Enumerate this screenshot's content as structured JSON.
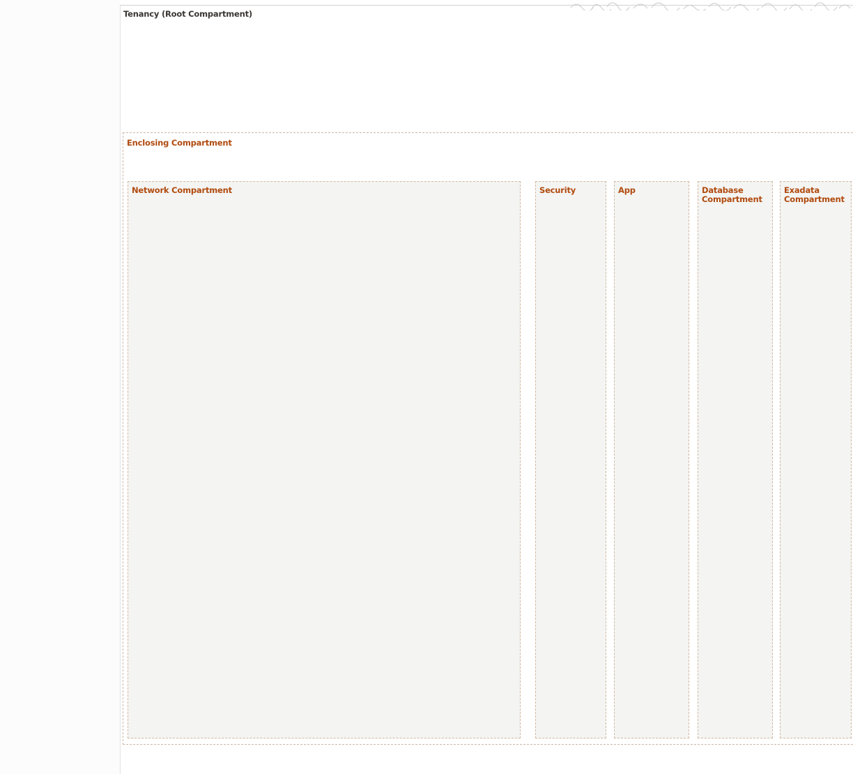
{
  "diagram": {
    "tenancy": {
      "label": "Tenancy (Root Compartment)"
    },
    "enclosing": {
      "label": "Enclosing Compartment"
    },
    "compartments": [
      {
        "id": "network",
        "label": "Network Compartment"
      },
      {
        "id": "security",
        "label": "Security"
      },
      {
        "id": "app",
        "label": "App"
      },
      {
        "id": "database",
        "label": "Database\nCompartment"
      },
      {
        "id": "exadata",
        "label": "Exadata\nCompartment"
      }
    ]
  },
  "colors": {
    "label_orange": "#b04a0e",
    "label_dark": "#3a3532",
    "compartment_fill": "#f4f4f2",
    "dashed_border": "#d1b8a3"
  },
  "icons": {
    "ornament": "decorative-pattern-icon"
  }
}
